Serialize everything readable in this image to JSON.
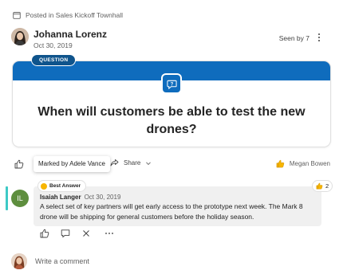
{
  "post": {
    "posted_in": "Posted in Sales Kickoff Townhall",
    "author": "Johanna Lorenz",
    "date": "Oct 30, 2019",
    "seen_by": "Seen by 7"
  },
  "question": {
    "badge": "QUESTION",
    "text": "When will customers be able to test the new drones?"
  },
  "actions": {
    "tooltip": "Marked by Adele Vance",
    "share_label": "Share",
    "reactor_name": "Megan Bowen"
  },
  "answer": {
    "best_label": "Best Answer",
    "avatar_initials": "IL",
    "author": "Isaiah Langer",
    "date": "Oct 30, 2019",
    "body": "A select set of key partners will get early access to the prototype next week. The Mark 8 drone will be shipping for general customers before the holiday season.",
    "reaction_count": "2"
  },
  "composer": {
    "placeholder": "Write a comment"
  },
  "colors": {
    "brand_blue": "#0f6cbd",
    "badge_blue": "#0f548c",
    "answer_accent": "#3dc9c6",
    "medal": "#f7b500",
    "avatar_green": "#5e8e3e"
  },
  "icons": [
    "calendar-icon",
    "more-icon",
    "question-icon",
    "like-icon",
    "share-icon",
    "chevron-down-icon",
    "reaction-icon",
    "medal-icon",
    "comment-icon",
    "close-icon"
  ]
}
